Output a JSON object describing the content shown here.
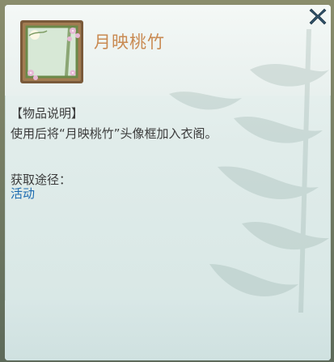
{
  "item": {
    "name": "月映桃竹",
    "icon": "bamboo-moon-avatar-frame-icon"
  },
  "description": {
    "section_title": "【物品说明】",
    "text": "使用后将“月映桃竹”头像框加入衣阁。"
  },
  "obtain": {
    "label": "获取途径：",
    "sources": [
      "活动"
    ]
  },
  "close_icon": "close-icon",
  "colors": {
    "title": "#c98a52",
    "link": "#1d6bb0",
    "text": "#3b3b3b"
  }
}
